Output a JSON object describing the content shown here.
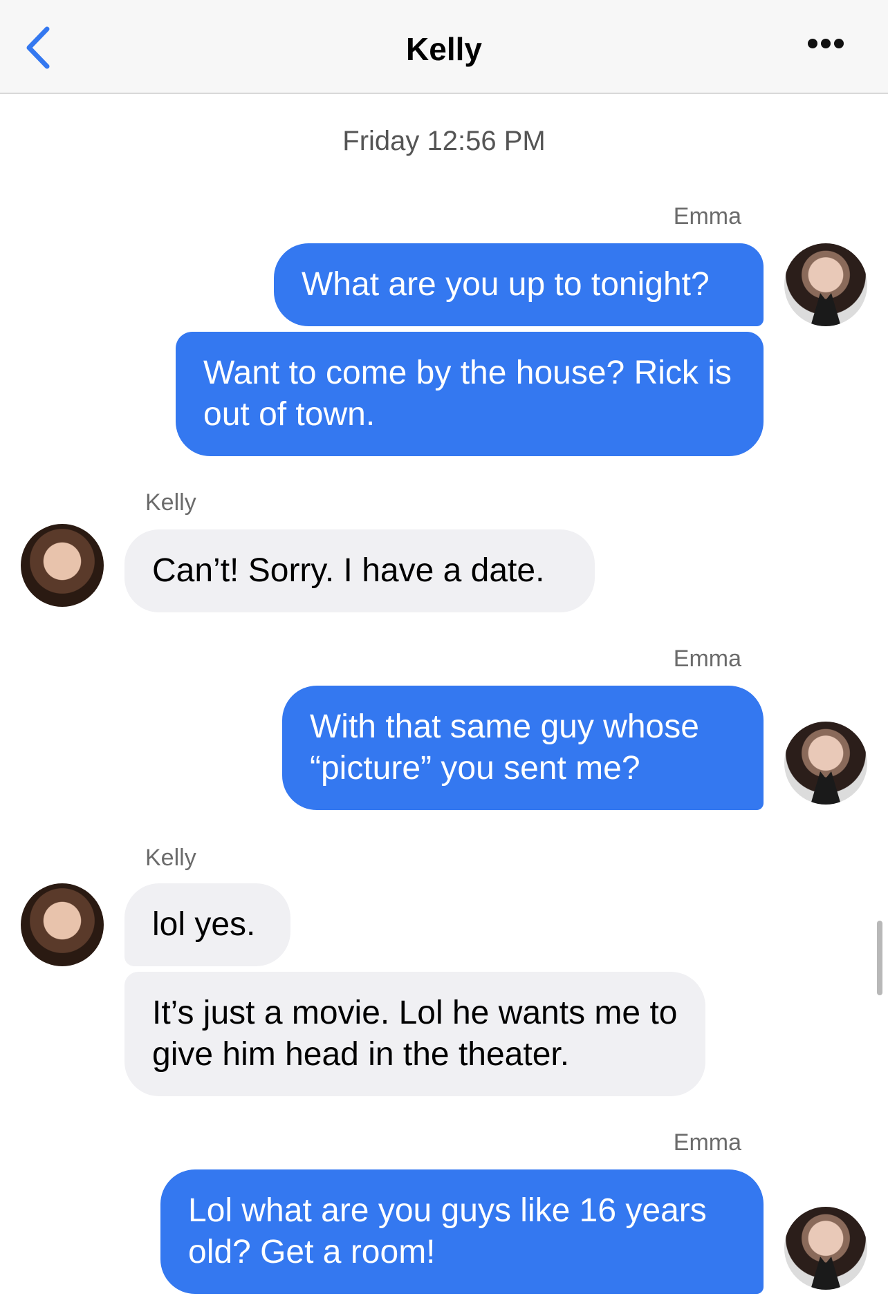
{
  "header": {
    "title": "Kelly",
    "back_icon": "chevron-left-icon",
    "more_icon": "ellipsis-icon"
  },
  "colors": {
    "outgoing_bubble": "#3478f0",
    "incoming_bubble": "#f0f0f3",
    "accent": "#3478f0"
  },
  "timestamp": "Friday 12:56 PM",
  "messages": [
    {
      "sender": "Emma",
      "text": "What are you up to tonight?"
    },
    {
      "text": "Want to come by the house? Rick is out of town."
    },
    {
      "sender": "Kelly",
      "text": "Can’t! Sorry. I have a date."
    },
    {
      "sender": "Emma",
      "text": "With that same guy whose “picture” you sent me?"
    },
    {
      "sender": "Kelly",
      "text": "lol yes."
    },
    {
      "text": "It’s just a movie. Lol he wants me to give him head in the theater."
    },
    {
      "sender": "Emma",
      "text": "Lol what are you guys like 16 years old? Get a room!"
    }
  ]
}
